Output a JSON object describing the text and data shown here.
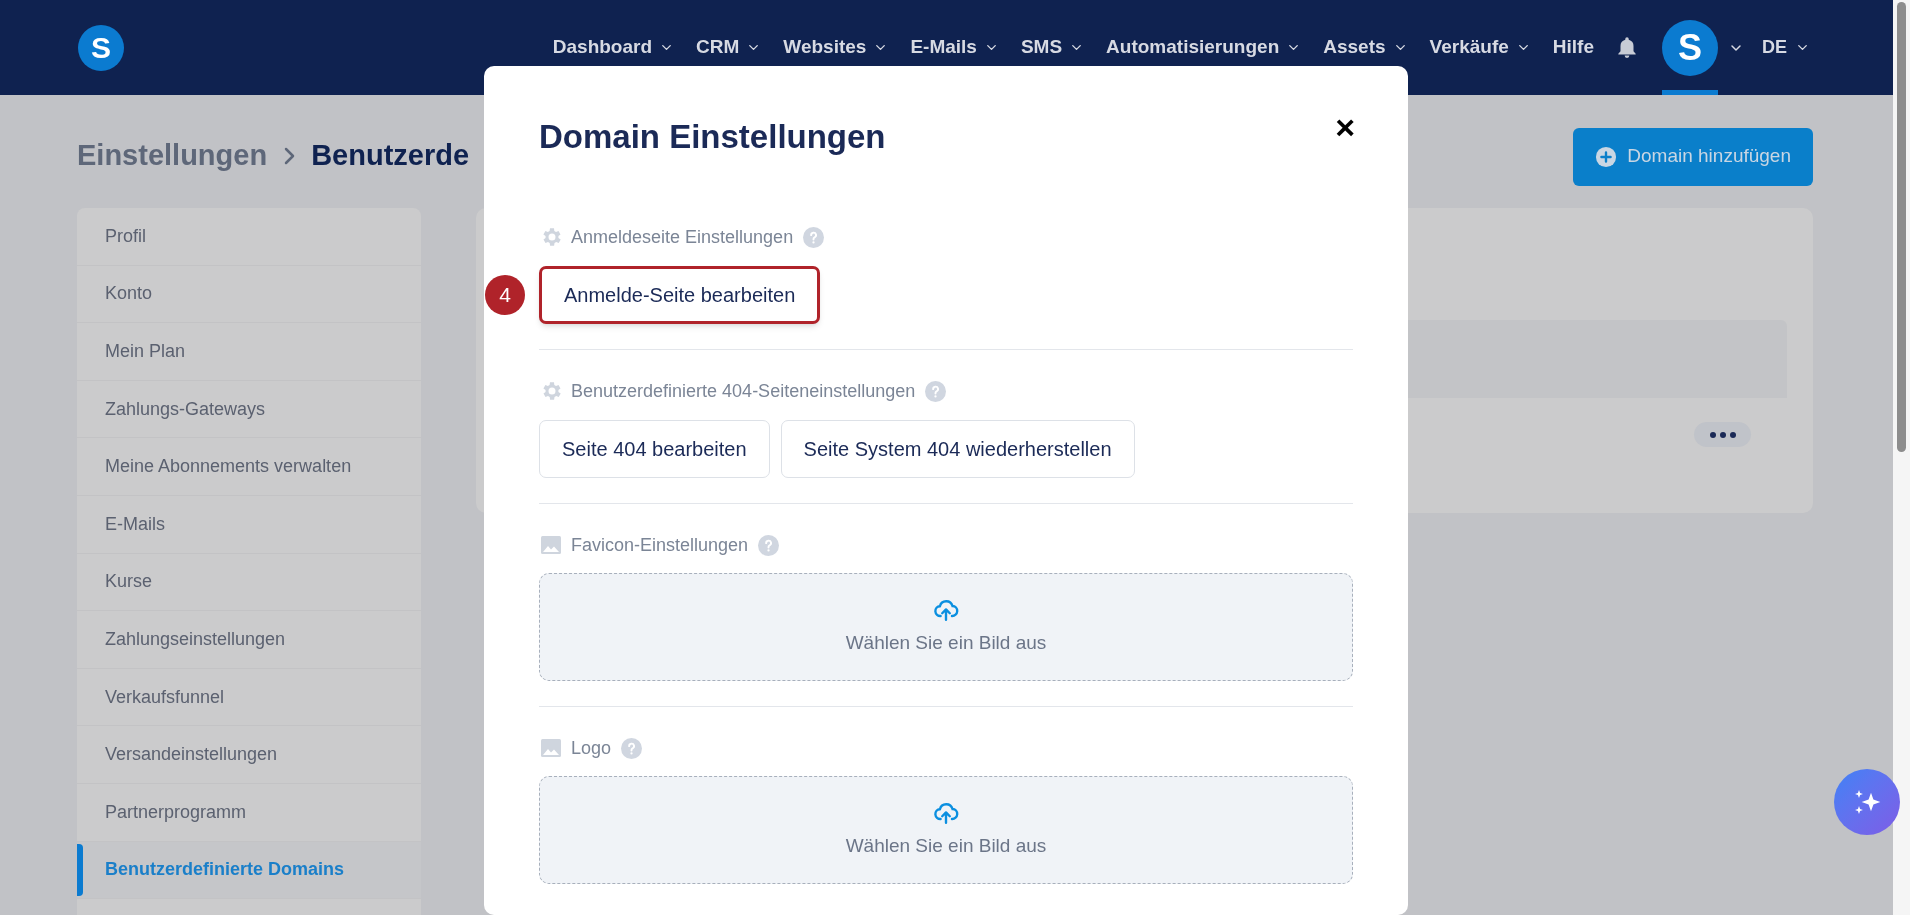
{
  "nav": {
    "logo": "S",
    "items": [
      {
        "label": "Dashboard",
        "dropdown": true
      },
      {
        "label": "CRM",
        "dropdown": true
      },
      {
        "label": "Websites",
        "dropdown": true
      },
      {
        "label": "E-Mails",
        "dropdown": true
      },
      {
        "label": "SMS",
        "dropdown": true
      },
      {
        "label": "Automatisierungen",
        "dropdown": true
      },
      {
        "label": "Assets",
        "dropdown": true
      },
      {
        "label": "Verkäufe",
        "dropdown": true
      },
      {
        "label": "Hilfe",
        "dropdown": false
      }
    ],
    "avatar": "S",
    "language": "DE"
  },
  "breadcrumb": [
    "Einstellungen",
    "Benutzerde"
  ],
  "add_button": "Domain hinzufügen",
  "sidebar": {
    "items": [
      {
        "label": "Profil",
        "selected": false
      },
      {
        "label": "Konto",
        "selected": false
      },
      {
        "label": "Mein Plan",
        "selected": false
      },
      {
        "label": "Zahlungs-Gateways",
        "selected": false
      },
      {
        "label": "Meine Abonnements verwalten",
        "selected": false
      },
      {
        "label": "E-Mails",
        "selected": false
      },
      {
        "label": "Kurse",
        "selected": false
      },
      {
        "label": "Zahlungseinstellungen",
        "selected": false
      },
      {
        "label": "Verkaufsfunnel",
        "selected": false
      },
      {
        "label": "Versandeinstellungen",
        "selected": false
      },
      {
        "label": "Partnerprogramm",
        "selected": false
      },
      {
        "label": "Benutzerdefinierte Domains",
        "selected": true
      }
    ]
  },
  "modal": {
    "title": "Domain Einstellungen",
    "close": "×",
    "sections": [
      {
        "kind": "buttons",
        "label": "Anmeldeseite Einstellungen",
        "buttons": [
          {
            "label": "Anmelde-Seite bearbeiten",
            "highlighted": true,
            "step": "4"
          }
        ]
      },
      {
        "kind": "buttons",
        "label": "Benutzerdefinierte 404-Seiteneinstellungen",
        "buttons": [
          {
            "label": "Seite 404 bearbeiten",
            "highlighted": false
          },
          {
            "label": "Seite System 404 wiederherstellen",
            "highlighted": false
          }
        ]
      },
      {
        "kind": "upload",
        "label": "Favicon-Einstellungen",
        "upload_text": "Wählen Sie ein Bild aus"
      },
      {
        "kind": "upload",
        "label": "Logo",
        "upload_text": "Wählen Sie ein Bild aus"
      }
    ]
  }
}
